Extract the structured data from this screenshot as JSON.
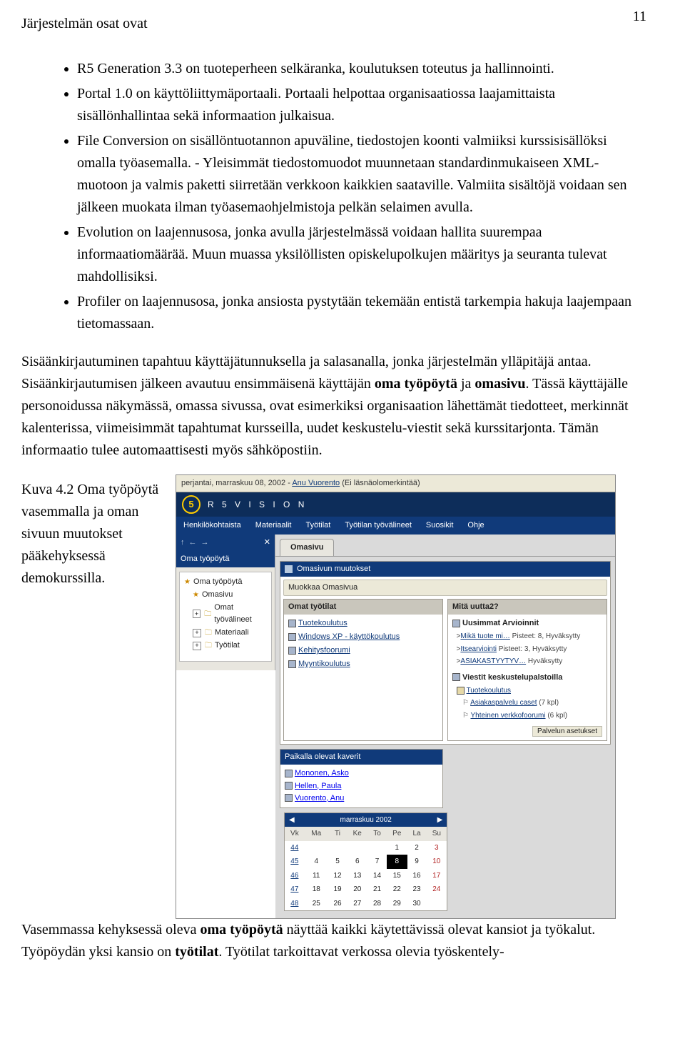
{
  "page_number": "11",
  "heading": "Järjestelmän osat ovat",
  "bullets": [
    "R5 Generation 3.3 on tuoteperheen selkäranka, koulutuksen toteutus ja hallinnointi.",
    "Portal 1.0 on käyttöliittymäportaali. Portaali helpottaa organisaatiossa laajamittaista sisällönhallintaa sekä informaation julkaisua.",
    "File Conversion on sisällöntuotannon apuväline, tiedostojen koonti valmiiksi kurssisisällöksi omalla työasemalla. - Yleisimmät tiedostomuodot muunnetaan standardinmukaiseen XML-muotoon ja valmis paketti siirretään verkkoon kaikkien saataville. Valmiita sisältöjä voidaan sen jälkeen muokata ilman työasemaohjelmistoja pelkän selaimen avulla.",
    "Evolution on laajennusosa, jonka avulla järjestelmässä voidaan hallita suurempaa informaatiomäärää. Muun muassa yksilöllisten opiskelupolkujen määritys ja seuranta tulevat mahdollisiksi.",
    "Profiler on laajennusosa, jonka ansiosta pystytään tekemään entistä tarkempia hakuja laajempaan tietomassaan."
  ],
  "p_body_before": "Sisäänkirjautuminen tapahtuu käyttäjätunnuksella ja salasanalla, jonka järjestelmän ylläpitäjä antaa. Sisäänkirjautumisen jälkeen avautuu ensimmäisenä käyttäjän ",
  "p_body_bold1": "oma työpöytä",
  "p_body_mid1": " ja ",
  "p_body_bold2": "omasivu",
  "p_body_after": ". Tässä käyttäjälle personoidussa näkymässä, omassa sivussa, ovat esimerkiksi organisaation lähettämät tiedotteet, merkinnät kalenterissa, viimeisimmät tapahtumat kursseilla, uudet keskustelu-viestit sekä kurssitarjonta. Tämän informaatio tulee automaattisesti myös sähköpostiin.",
  "caption": "Kuva 4.2 Oma työpöytä vasemmalla ja oman sivuun muutokset pääkehyksessä demokurssilla.",
  "shot": {
    "date_prefix": "perjantai, marraskuu 08, 2002 - ",
    "user_name": "Anu Vuorento",
    "date_suffix": " (Ei läsnäolomerkintää)",
    "product": "R 5   V I S I O N",
    "menu": [
      "Henkilökohtaista",
      "Materiaalit",
      "Työtilat",
      "Työtilan työvälineet",
      "Suosikit",
      "Ohje"
    ],
    "nav_title": "Oma työpöytä",
    "nav_arrows_x": "✕",
    "tree": [
      {
        "g": "",
        "icon": "★",
        "text": "Oma työpöytä",
        "indent": 0,
        "star": true
      },
      {
        "g": "",
        "icon": "★",
        "text": "Omasivu",
        "indent": 1,
        "star": true
      },
      {
        "g": "+",
        "icon": "🗀",
        "text": "Omat työvälineet",
        "indent": 1
      },
      {
        "g": "+",
        "icon": "🗀",
        "text": "Materiaali",
        "indent": 1
      },
      {
        "g": "+",
        "icon": "🗀",
        "text": "Työtilat",
        "indent": 1
      }
    ],
    "tab_label": "Omasivu",
    "section_title": "Omasivun muutokset",
    "edit_btn": "Muokkaa Omasivua",
    "cols_left_title": "Omat työtilat",
    "cols_left_items": [
      {
        "t": "Tuotekoulutus"
      },
      {
        "t": "Windows XP - käyttökoulutus"
      },
      {
        "t": "Kehitysfoorumi"
      },
      {
        "t": "Myyntikoulutus"
      }
    ],
    "cols_right_title": "Mitä uutta2?",
    "news_group1_title": "Uusimmat Arvioinnit",
    "news_group1": [
      {
        "a": "Mikä tuote mi…",
        "s": " Pisteet: 8, Hyväksytty"
      },
      {
        "a": "Itsearviointi",
        "s": " Pisteet: 3, Hyväksytty"
      },
      {
        "a": "ASIAKASTYYTYV…",
        "s": " Hyväksytty"
      }
    ],
    "news_group2_title": "Viestit keskustelupalstoilla",
    "news_group2_item": "Tuotekoulutus",
    "news_group2_sub": [
      {
        "a": "Asiakaspalvelu caset",
        "c": "(7 kpl)"
      },
      {
        "a": "Yhteinen verkkofoorumi",
        "c": "(6 kpl)"
      }
    ],
    "service_settings": "Palvelun asetukset",
    "friends_title": "Paikalla olevat kaverit",
    "friends": [
      "Mononen, Asko",
      "Hellen, Paula",
      "Vuorento, Anu"
    ],
    "cal_title": "marraskuu 2002",
    "cal_dow": [
      "Vk",
      "Ma",
      "Ti",
      "Ke",
      "To",
      "Pe",
      "La",
      "Su"
    ],
    "cal_rows": [
      [
        "44",
        "",
        "",
        "",
        "",
        "1",
        "2",
        "3"
      ],
      [
        "45",
        "4",
        "5",
        "6",
        "7",
        "8",
        "9",
        "10"
      ],
      [
        "46",
        "11",
        "12",
        "13",
        "14",
        "15",
        "16",
        "17"
      ],
      [
        "47",
        "18",
        "19",
        "20",
        "21",
        "22",
        "23",
        "24"
      ],
      [
        "48",
        "25",
        "26",
        "27",
        "28",
        "29",
        "30",
        ""
      ]
    ]
  },
  "bottom_before": "Vasemmassa kehyksessä oleva ",
  "bottom_b1": "oma työpöytä",
  "bottom_mid1": " näyttää kaikki käytettävissä olevat kansiot ja työkalut. Työpöydän yksi kansio on ",
  "bottom_b2": "työtilat",
  "bottom_after": ". Työtilat tarkoittavat verkossa olevia työskentely-"
}
